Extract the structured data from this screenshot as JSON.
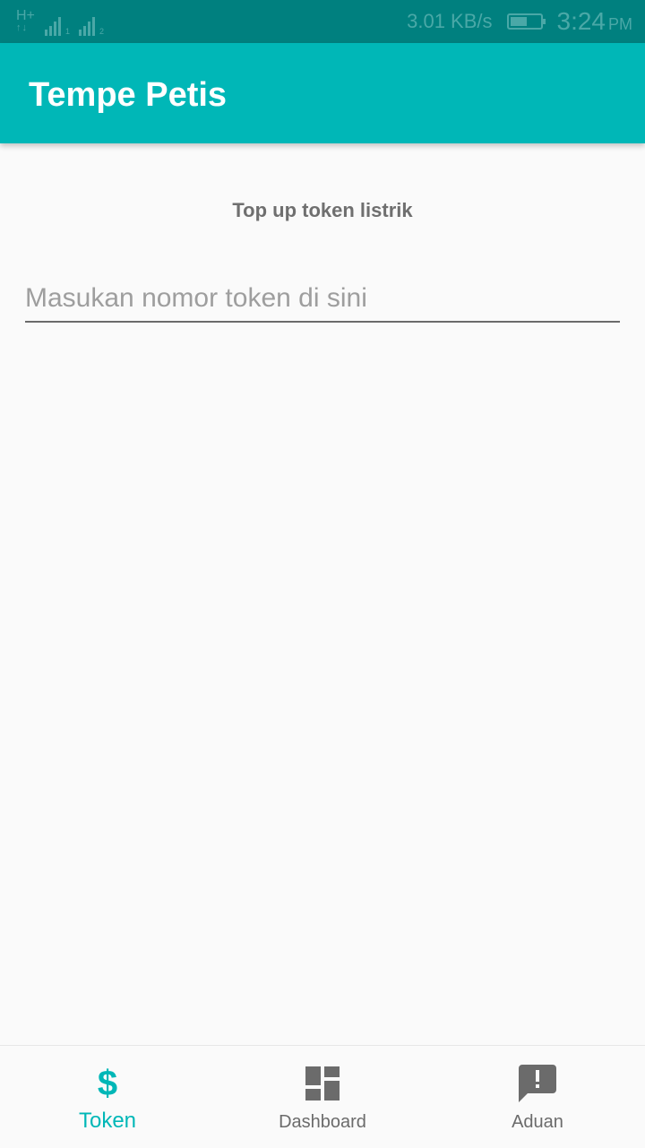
{
  "status_bar": {
    "network_type": "H+",
    "sim1_label": "1",
    "sim2_label": "2",
    "speed": "3.01 KB/s",
    "time": "3:24",
    "ampm": "PM"
  },
  "app_bar": {
    "title": "Tempe Petis"
  },
  "main": {
    "section_title": "Top up token listrik",
    "token_input": {
      "placeholder": "Masukan nomor token di sini",
      "value": ""
    }
  },
  "bottom_nav": {
    "items": [
      {
        "label": "Token",
        "icon": "dollar-icon",
        "active": true
      },
      {
        "label": "Dashboard",
        "icon": "dashboard-icon",
        "active": false
      },
      {
        "label": "Aduan",
        "icon": "feedback-icon",
        "active": false
      }
    ]
  },
  "colors": {
    "primary": "#00b7b7",
    "status_bar": "#00807f",
    "inactive_nav": "#6b6b6b",
    "background": "#fafafa"
  }
}
